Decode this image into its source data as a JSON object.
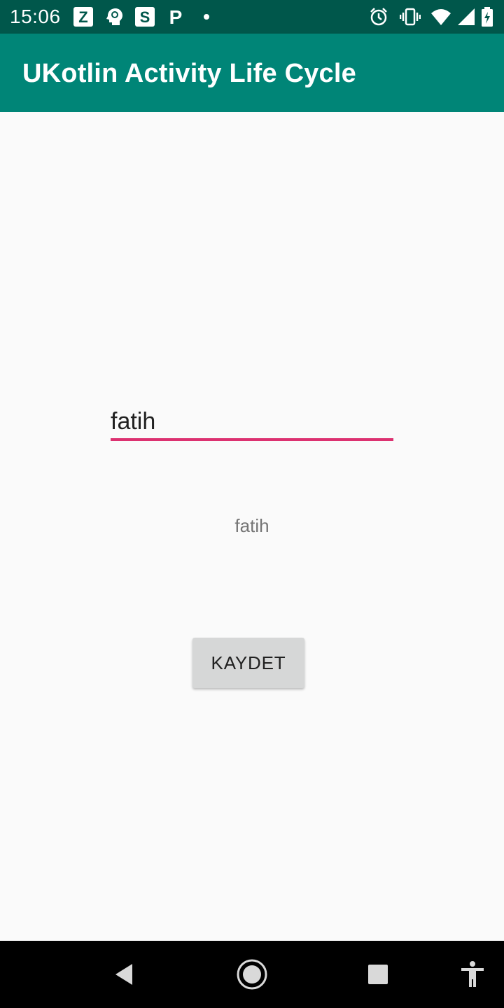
{
  "status_bar": {
    "time": "15:06",
    "notification_icons": [
      "zedge-icon",
      "brain-icon",
      "s-app-icon",
      "p-app-icon",
      "dot-icon"
    ],
    "system_icons": [
      "alarm-icon",
      "vibrate-icon",
      "wifi-icon",
      "signal-icon",
      "battery-charging-icon"
    ],
    "notif_letters": {
      "z": "Z",
      "s": "S",
      "p": "P"
    }
  },
  "app_bar": {
    "title": "UKotlin Activity Life Cycle",
    "color": "#008577"
  },
  "main": {
    "name_input_value": "fatih",
    "result_text": "fatih",
    "save_label": "KAYDET",
    "accent_color": "#d81b60"
  },
  "nav_bar": {
    "buttons": [
      "back-icon",
      "home-icon",
      "recents-icon",
      "accessibility-icon"
    ]
  }
}
